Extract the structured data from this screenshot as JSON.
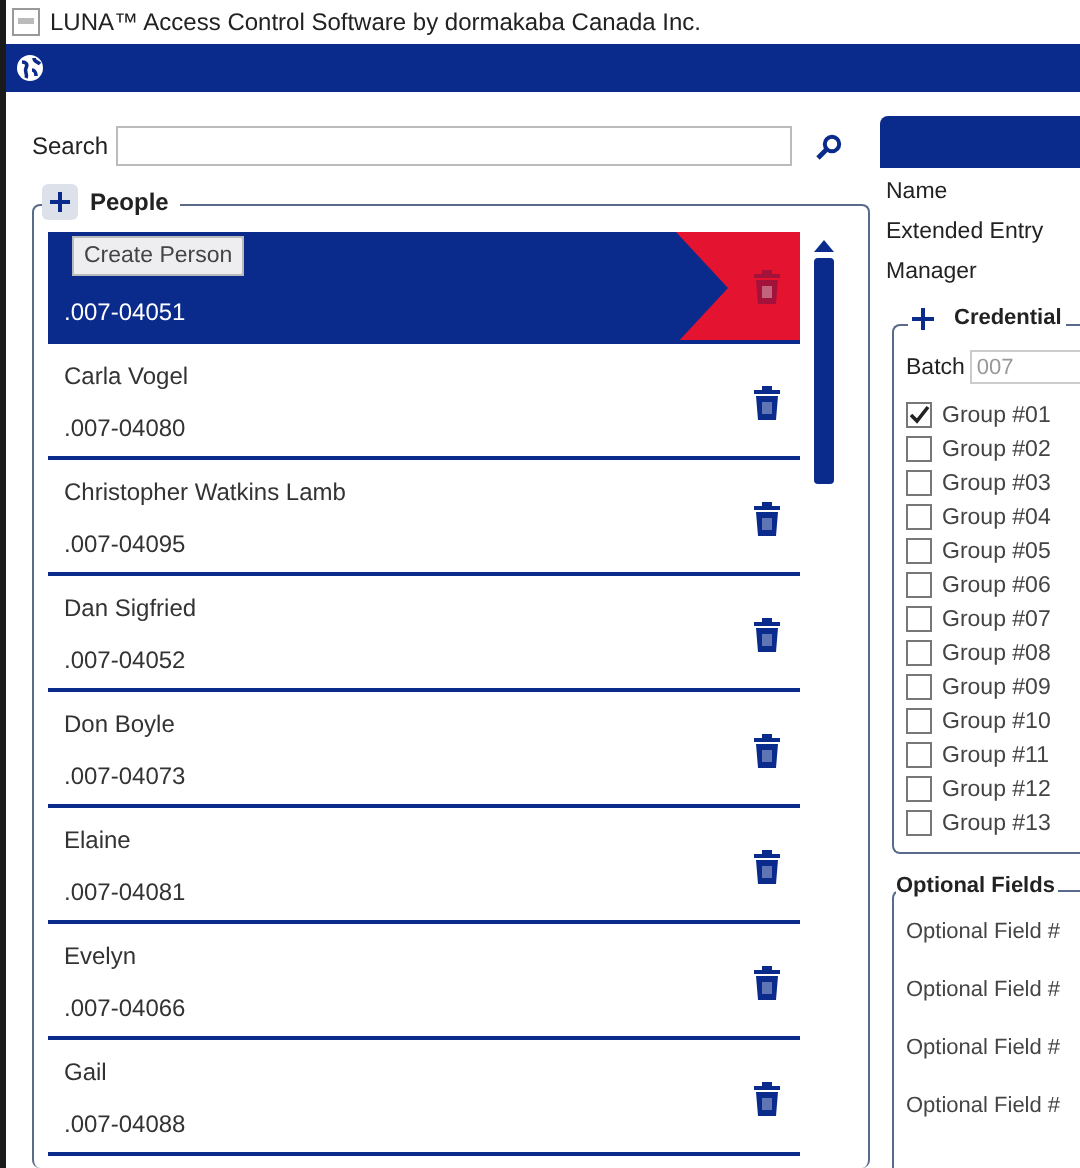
{
  "window": {
    "title": "LUNA™ Access Control Software by dormakaba Canada Inc."
  },
  "search": {
    "label": "Search"
  },
  "people": {
    "title": "People",
    "add_tooltip": "Create Person",
    "persons": [
      {
        "number": ".007-04051",
        "selected": true
      },
      {
        "name": "Carla Vogel",
        "number": ".007-04080",
        "selected": false
      },
      {
        "name": "Christopher Watkins Lamb",
        "number": ".007-04095",
        "selected": false
      },
      {
        "name": "Dan Sigfried",
        "number": ".007-04052",
        "selected": false
      },
      {
        "name": "Don Boyle",
        "number": ".007-04073",
        "selected": false
      },
      {
        "name": "Elaine",
        "number": ".007-04081",
        "selected": false
      },
      {
        "name": "Evelyn",
        "number": ".007-04066",
        "selected": false
      },
      {
        "name": "Gail",
        "number": ".007-04088",
        "selected": false
      }
    ]
  },
  "details": {
    "fields": [
      "Name",
      "Extended Entry",
      "Manager"
    ],
    "credentials": {
      "title": "Credential",
      "batch_label": "Batch",
      "batch_placeholder": "007",
      "groups": [
        {
          "label": "Group #01",
          "checked": true
        },
        {
          "label": "Group #02",
          "checked": false
        },
        {
          "label": "Group #03",
          "checked": false
        },
        {
          "label": "Group #04",
          "checked": false
        },
        {
          "label": "Group #05",
          "checked": false
        },
        {
          "label": "Group #06",
          "checked": false
        },
        {
          "label": "Group #07",
          "checked": false
        },
        {
          "label": "Group #08",
          "checked": false
        },
        {
          "label": "Group #09",
          "checked": false
        },
        {
          "label": "Group #10",
          "checked": false
        },
        {
          "label": "Group #11",
          "checked": false
        },
        {
          "label": "Group #12",
          "checked": false
        },
        {
          "label": "Group #13",
          "checked": false
        }
      ]
    },
    "optional_fields": {
      "title": "Optional Fields",
      "fields": [
        "Optional Field #",
        "Optional Field #",
        "Optional Field #",
        "Optional Field #"
      ]
    }
  }
}
